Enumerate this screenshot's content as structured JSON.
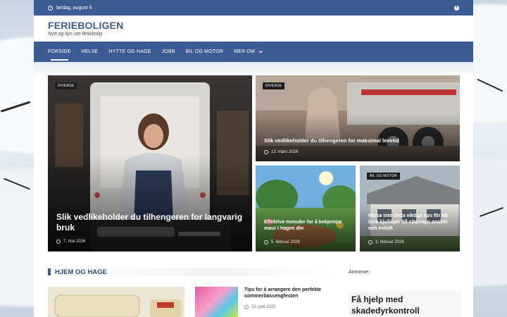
{
  "topbar": {
    "date": "lørdag, august 6",
    "social_icon": "facebook-icon"
  },
  "site": {
    "title": "FERIEBOLIGEN",
    "tagline": "Nytt og tips om feriebolig"
  },
  "nav": {
    "items": [
      {
        "label": "FORSIDE",
        "active": true
      },
      {
        "label": "HELSE"
      },
      {
        "label": "HYTTE OG HAGE"
      },
      {
        "label": "JOBB"
      },
      {
        "label": "BIL OG MOTOR"
      },
      {
        "label": "MER OM",
        "dropdown": true
      }
    ]
  },
  "featured": [
    {
      "category": "DIVERSE",
      "title": "Slik vedlikeholder du tilhengeren for langvarig bruk",
      "date": "7. mai 2026"
    },
    {
      "category": "DIVERSE",
      "title": "Slik vedlikeholder du tilhengeren for maksimal levetid",
      "date": "12. mars 2026"
    },
    {
      "category": "",
      "title": "Effektive metoder for å bekjempe maur i hagen din",
      "date": "5. februar 2026"
    },
    {
      "category": "BIL OG MOTOR",
      "title": "Missa inte detta viktiga tips för att byta hjullager till släpvagn snabbt och enkelt",
      "date": "3. februar 2026"
    }
  ],
  "section": {
    "title": "HJEM OG HAGE",
    "articles": [
      {
        "title": "Tips for å arrangere den perfekte sommerbassengfesten",
        "date": "21. juni 2022"
      }
    ]
  },
  "sidebar": {
    "ad_label": "Annonse:",
    "ad_text": "Få hjelp med skadedyrkontroll"
  },
  "colors": {
    "brand": "#3b5b95"
  }
}
